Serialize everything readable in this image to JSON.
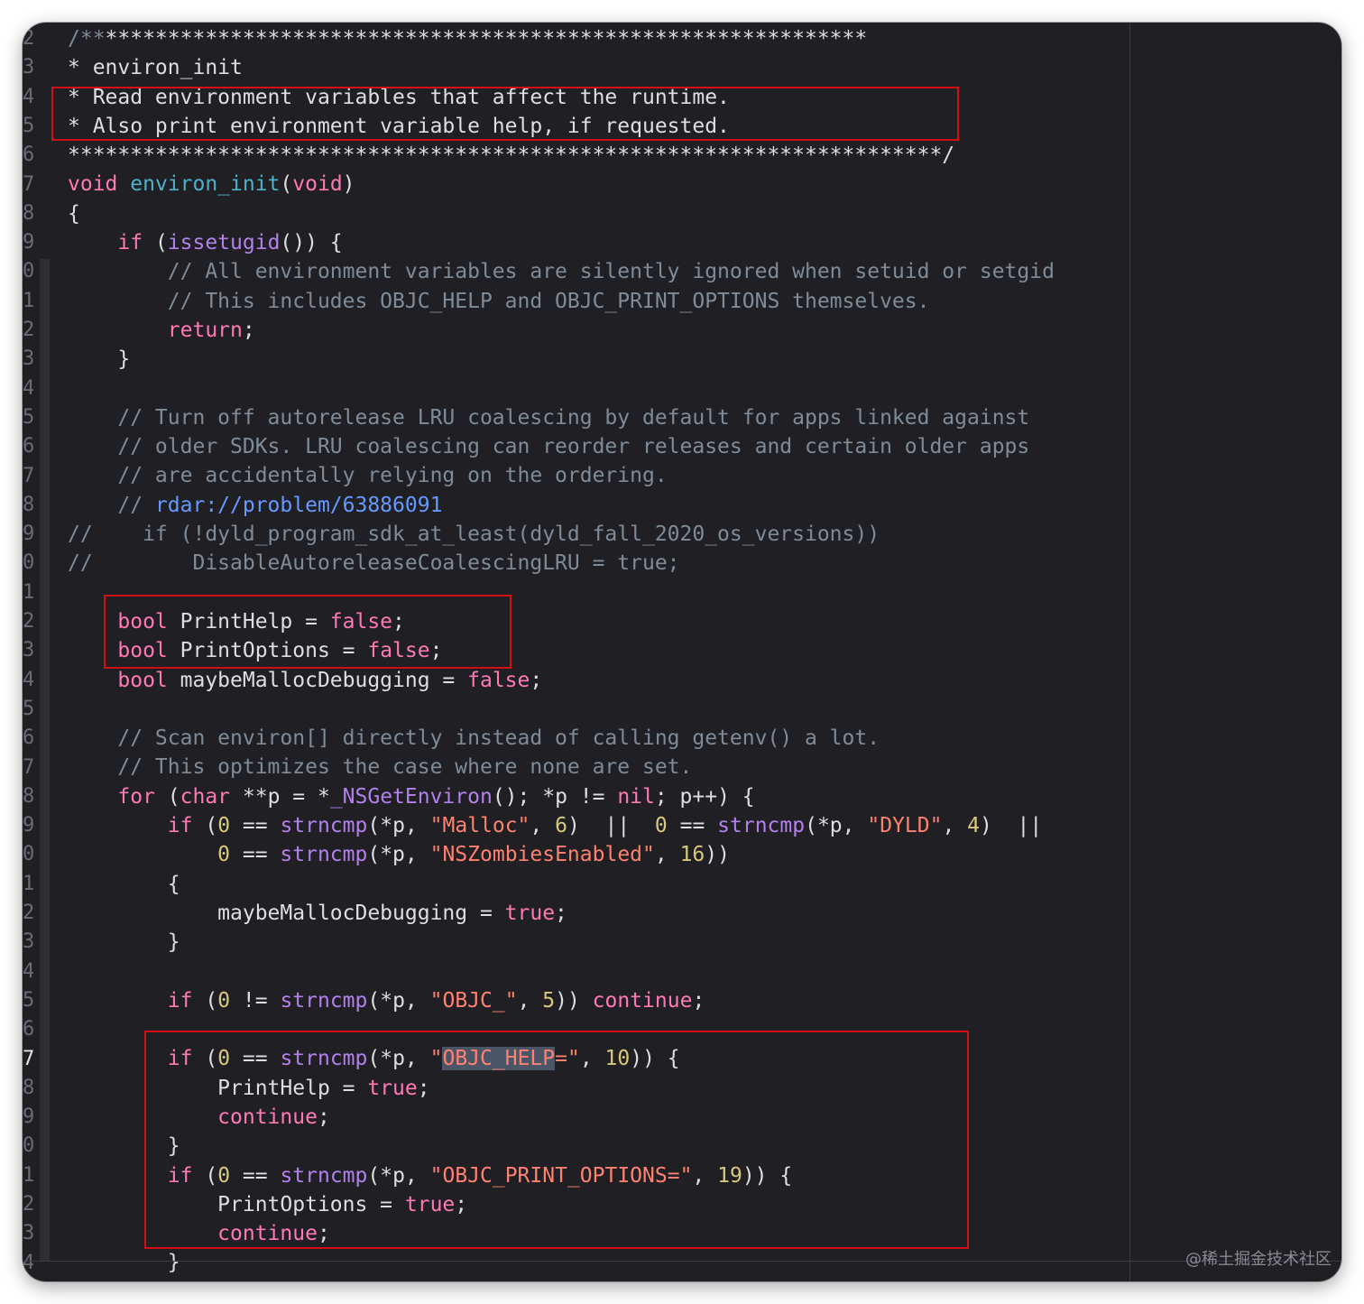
{
  "editor": {
    "line_numbers": [
      "2",
      "3",
      "4",
      "5",
      "6",
      "7",
      "8",
      "9",
      "0",
      "1",
      "2",
      "3",
      "4",
      "5",
      "6",
      "7",
      "8",
      "9",
      "0",
      "1",
      "2",
      "3",
      "4",
      "5",
      "6",
      "7",
      "8",
      "9",
      "0",
      "1",
      "2",
      "3",
      "4",
      "5",
      "6",
      "7",
      "8",
      "9",
      "0",
      "1",
      "2",
      "3",
      "4"
    ],
    "current_line_index": 35,
    "code_lines": [
      [
        {
          "t": "/**",
          "c": "cm"
        },
        {
          "t": "*************************************************************",
          "c": ""
        }
      ],
      [
        {
          "t": "* environ_init",
          "c": ""
        }
      ],
      [
        {
          "t": "* Read environment variables that affect the runtime.",
          "c": ""
        }
      ],
      [
        {
          "t": "* Also print environment variable help, if requested.",
          "c": ""
        }
      ],
      [
        {
          "t": "**********************************************************************/",
          "c": ""
        }
      ],
      [
        {
          "t": "void",
          "c": "kw"
        },
        {
          "t": " ",
          "c": ""
        },
        {
          "t": "environ_init",
          "c": "dec"
        },
        {
          "t": "(",
          "c": ""
        },
        {
          "t": "void",
          "c": "kw"
        },
        {
          "t": ")",
          "c": ""
        }
      ],
      [
        {
          "t": "{",
          "c": ""
        }
      ],
      [
        {
          "t": "    ",
          "c": ""
        },
        {
          "t": "if",
          "c": "kw"
        },
        {
          "t": " (",
          "c": ""
        },
        {
          "t": "issetugid",
          "c": "fn"
        },
        {
          "t": "()) {",
          "c": ""
        }
      ],
      [
        {
          "t": "        // All environment variables are silently ignored when setuid or setgid",
          "c": "cm"
        }
      ],
      [
        {
          "t": "        // This includes OBJC_HELP and OBJC_PRINT_OPTIONS themselves.",
          "c": "cm"
        }
      ],
      [
        {
          "t": "        ",
          "c": ""
        },
        {
          "t": "return",
          "c": "kw"
        },
        {
          "t": ";",
          "c": ""
        }
      ],
      [
        {
          "t": "    }",
          "c": ""
        }
      ],
      [
        {
          "t": "",
          "c": ""
        }
      ],
      [
        {
          "t": "    // Turn off autorelease LRU coalescing by default for apps linked against",
          "c": "cm"
        }
      ],
      [
        {
          "t": "    // older SDKs. LRU coalescing can reorder releases and certain older apps",
          "c": "cm"
        }
      ],
      [
        {
          "t": "    // are accidentally relying on the ordering.",
          "c": "cm"
        }
      ],
      [
        {
          "t": "    // ",
          "c": "cm"
        },
        {
          "t": "rdar://problem/63886091",
          "c": "url"
        }
      ],
      [
        {
          "t": "//    if (!dyld_program_sdk_at_least(dyld_fall_2020_os_versions))",
          "c": "cm"
        }
      ],
      [
        {
          "t": "//        DisableAutoreleaseCoalescingLRU = true;",
          "c": "cm"
        }
      ],
      [
        {
          "t": "",
          "c": ""
        }
      ],
      [
        {
          "t": "    ",
          "c": ""
        },
        {
          "t": "bool",
          "c": "kw"
        },
        {
          "t": " PrintHelp = ",
          "c": ""
        },
        {
          "t": "false",
          "c": "kw"
        },
        {
          "t": ";",
          "c": ""
        }
      ],
      [
        {
          "t": "    ",
          "c": ""
        },
        {
          "t": "bool",
          "c": "kw"
        },
        {
          "t": " PrintOptions = ",
          "c": ""
        },
        {
          "t": "false",
          "c": "kw"
        },
        {
          "t": ";",
          "c": ""
        }
      ],
      [
        {
          "t": "    ",
          "c": ""
        },
        {
          "t": "bool",
          "c": "kw"
        },
        {
          "t": " maybeMallocDebugging = ",
          "c": ""
        },
        {
          "t": "false",
          "c": "kw"
        },
        {
          "t": ";",
          "c": ""
        }
      ],
      [
        {
          "t": "",
          "c": ""
        }
      ],
      [
        {
          "t": "    // Scan environ[] directly instead of calling getenv() a lot.",
          "c": "cm"
        }
      ],
      [
        {
          "t": "    // This optimizes the case where none are set.",
          "c": "cm"
        }
      ],
      [
        {
          "t": "    ",
          "c": ""
        },
        {
          "t": "for",
          "c": "kw"
        },
        {
          "t": " (",
          "c": ""
        },
        {
          "t": "char",
          "c": "kw"
        },
        {
          "t": " **p = *",
          "c": ""
        },
        {
          "t": "_NSGetEnviron",
          "c": "fn"
        },
        {
          "t": "(); *p != ",
          "c": ""
        },
        {
          "t": "nil",
          "c": "kw"
        },
        {
          "t": "; p++) {",
          "c": ""
        }
      ],
      [
        {
          "t": "        ",
          "c": ""
        },
        {
          "t": "if",
          "c": "kw"
        },
        {
          "t": " (",
          "c": ""
        },
        {
          "t": "0",
          "c": "num"
        },
        {
          "t": " == ",
          "c": ""
        },
        {
          "t": "strncmp",
          "c": "fn"
        },
        {
          "t": "(*p, ",
          "c": ""
        },
        {
          "t": "\"Malloc\"",
          "c": "str"
        },
        {
          "t": ", ",
          "c": ""
        },
        {
          "t": "6",
          "c": "num"
        },
        {
          "t": ")  ||  ",
          "c": ""
        },
        {
          "t": "0",
          "c": "num"
        },
        {
          "t": " == ",
          "c": ""
        },
        {
          "t": "strncmp",
          "c": "fn"
        },
        {
          "t": "(*p, ",
          "c": ""
        },
        {
          "t": "\"DYLD\"",
          "c": "str"
        },
        {
          "t": ", ",
          "c": ""
        },
        {
          "t": "4",
          "c": "num"
        },
        {
          "t": ")  ||",
          "c": ""
        }
      ],
      [
        {
          "t": "            ",
          "c": ""
        },
        {
          "t": "0",
          "c": "num"
        },
        {
          "t": " == ",
          "c": ""
        },
        {
          "t": "strncmp",
          "c": "fn"
        },
        {
          "t": "(*p, ",
          "c": ""
        },
        {
          "t": "\"NSZombiesEnabled\"",
          "c": "str"
        },
        {
          "t": ", ",
          "c": ""
        },
        {
          "t": "16",
          "c": "num"
        },
        {
          "t": "))",
          "c": ""
        }
      ],
      [
        {
          "t": "        {",
          "c": ""
        }
      ],
      [
        {
          "t": "            maybeMallocDebugging = ",
          "c": ""
        },
        {
          "t": "true",
          "c": "kw"
        },
        {
          "t": ";",
          "c": ""
        }
      ],
      [
        {
          "t": "        }",
          "c": ""
        }
      ],
      [
        {
          "t": "",
          "c": ""
        }
      ],
      [
        {
          "t": "        ",
          "c": ""
        },
        {
          "t": "if",
          "c": "kw"
        },
        {
          "t": " (",
          "c": ""
        },
        {
          "t": "0",
          "c": "num"
        },
        {
          "t": " != ",
          "c": ""
        },
        {
          "t": "strncmp",
          "c": "fn"
        },
        {
          "t": "(*p, ",
          "c": ""
        },
        {
          "t": "\"OBJC_\"",
          "c": "str"
        },
        {
          "t": ", ",
          "c": ""
        },
        {
          "t": "5",
          "c": "num"
        },
        {
          "t": ")) ",
          "c": ""
        },
        {
          "t": "continue",
          "c": "kw"
        },
        {
          "t": ";",
          "c": ""
        }
      ],
      [
        {
          "t": "",
          "c": ""
        }
      ],
      [
        {
          "t": "        ",
          "c": ""
        },
        {
          "t": "if",
          "c": "kw"
        },
        {
          "t": " (",
          "c": ""
        },
        {
          "t": "0",
          "c": "num"
        },
        {
          "t": " == ",
          "c": ""
        },
        {
          "t": "strncmp",
          "c": "fn"
        },
        {
          "t": "(*p, ",
          "c": ""
        },
        {
          "t": "\"",
          "c": "str"
        },
        {
          "t": "OBJC_HELP",
          "c": "str hl"
        },
        {
          "t": "=\"",
          "c": "str"
        },
        {
          "t": ", ",
          "c": ""
        },
        {
          "t": "10",
          "c": "num"
        },
        {
          "t": ")) {",
          "c": ""
        }
      ],
      [
        {
          "t": "            PrintHelp = ",
          "c": ""
        },
        {
          "t": "true",
          "c": "kw"
        },
        {
          "t": ";",
          "c": ""
        }
      ],
      [
        {
          "t": "            ",
          "c": ""
        },
        {
          "t": "continue",
          "c": "kw"
        },
        {
          "t": ";",
          "c": ""
        }
      ],
      [
        {
          "t": "        }",
          "c": ""
        }
      ],
      [
        {
          "t": "        ",
          "c": ""
        },
        {
          "t": "if",
          "c": "kw"
        },
        {
          "t": " (",
          "c": ""
        },
        {
          "t": "0",
          "c": "num"
        },
        {
          "t": " == ",
          "c": ""
        },
        {
          "t": "strncmp",
          "c": "fn"
        },
        {
          "t": "(*p, ",
          "c": ""
        },
        {
          "t": "\"OBJC_PRINT_OPTIONS=\"",
          "c": "str"
        },
        {
          "t": ", ",
          "c": ""
        },
        {
          "t": "19",
          "c": "num"
        },
        {
          "t": ")) {",
          "c": ""
        }
      ],
      [
        {
          "t": "            PrintOptions = ",
          "c": ""
        },
        {
          "t": "true",
          "c": "kw"
        },
        {
          "t": ";",
          "c": ""
        }
      ],
      [
        {
          "t": "            ",
          "c": ""
        },
        {
          "t": "continue",
          "c": "kw"
        },
        {
          "t": ";",
          "c": ""
        }
      ],
      [
        {
          "t": "        }",
          "c": ""
        }
      ]
    ]
  },
  "annotations": {
    "box_color": "#d10f15",
    "boxes": [
      {
        "name": "annotation-box-comment",
        "from_line": 2,
        "to_line": 3
      },
      {
        "name": "annotation-box-print-flags",
        "from_line": 20,
        "to_line": 21
      },
      {
        "name": "annotation-box-objc-help-checks",
        "from_line": 35,
        "to_line": 41
      }
    ]
  },
  "watermark": "@稀土掘金技术社区"
}
